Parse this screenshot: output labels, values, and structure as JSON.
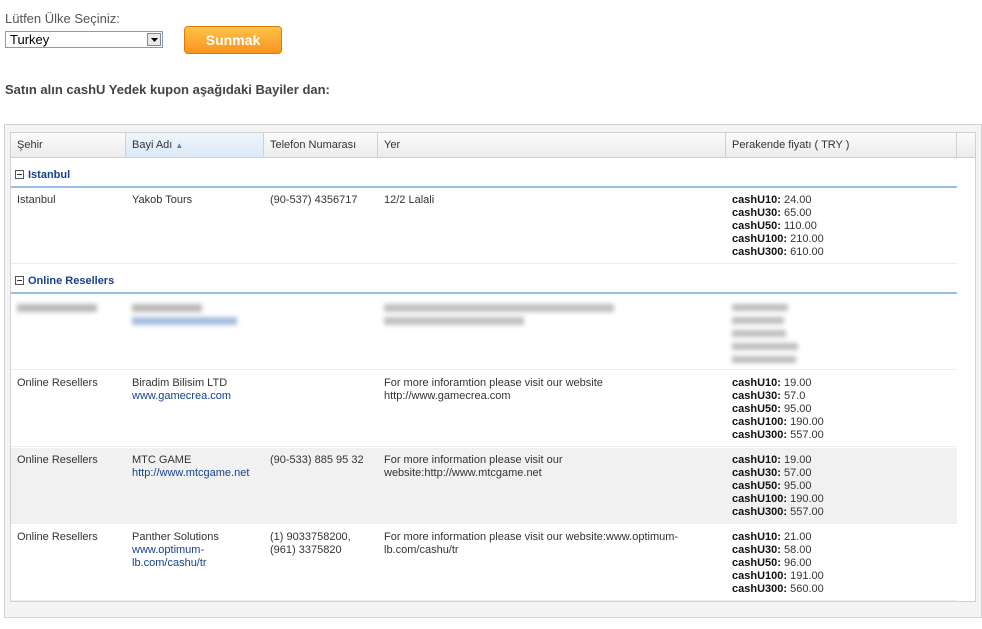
{
  "form": {
    "country_label": "Lütfen Ülke Seçiniz:",
    "country_selected": "Turkey",
    "submit_label": "Sunmak"
  },
  "heading": "Satın alın cashU Yedek kupon aşağıdaki Bayiler dan:",
  "table": {
    "columns": [
      "Şehir",
      "Bayi Adı",
      "Telefon Numarası",
      "Yer",
      "Perakende fiyatı ( TRY )"
    ],
    "groups": [
      {
        "name": "Istanbul",
        "rows": [
          {
            "city": "Istanbul",
            "dealer": "Yakob Tours",
            "website": "",
            "phone": "(90-537) 4356717",
            "location": "12/2 Lalali",
            "prices": [
              {
                "label": "cashU10:",
                "value": "24.00"
              },
              {
                "label": "cashU30:",
                "value": "65.00"
              },
              {
                "label": "cashU50:",
                "value": "110.00"
              },
              {
                "label": "cashU100:",
                "value": "210.00"
              },
              {
                "label": "cashU300:",
                "value": "610.00"
              }
            ]
          }
        ]
      },
      {
        "name": "Online Resellers",
        "rows": [
          {
            "city": "Online Resellers",
            "dealer": "Biradim Bilisim LTD",
            "website": "www.gamecrea.com",
            "phone": "",
            "location": "For more inforamtion please visit our website http://www.gamecrea.com",
            "prices": [
              {
                "label": "cashU10:",
                "value": "19.00"
              },
              {
                "label": "cashU30:",
                "value": "57.0"
              },
              {
                "label": "cashU50:",
                "value": "95.00"
              },
              {
                "label": "cashU100:",
                "value": "190.00"
              },
              {
                "label": "cashU300:",
                "value": "557.00"
              }
            ]
          },
          {
            "city": "Online Resellers",
            "dealer": "MTC GAME",
            "website": "http://www.mtcgame.net",
            "phone": "(90-533) 885 95 32",
            "location": "For more information please visit our website:http://www.mtcgame.net",
            "prices": [
              {
                "label": "cashU10:",
                "value": "19.00"
              },
              {
                "label": "cashU30:",
                "value": "57.00"
              },
              {
                "label": "cashU50:",
                "value": "95.00"
              },
              {
                "label": "cashU100:",
                "value": "190.00"
              },
              {
                "label": "cashU300:",
                "value": "557.00"
              }
            ]
          },
          {
            "city": "Online Resellers",
            "dealer": "Panther Solutions",
            "website": "www.optimum-lb.com/cashu/tr",
            "phone": "(1) 9033758200, (961) 3375820",
            "location": "For more information please visit our website:www.optimum-lb.com/cashu/tr",
            "prices": [
              {
                "label": "cashU10:",
                "value": "21.00"
              },
              {
                "label": "cashU30:",
                "value": "58.00"
              },
              {
                "label": "cashU50:",
                "value": "96.00"
              },
              {
                "label": "cashU100:",
                "value": "191.00"
              },
              {
                "label": "cashU300:",
                "value": "560.00"
              }
            ]
          }
        ]
      }
    ]
  },
  "colors": {
    "accent": "#f7941d",
    "group_text": "#15428b",
    "link": "#15428b"
  }
}
